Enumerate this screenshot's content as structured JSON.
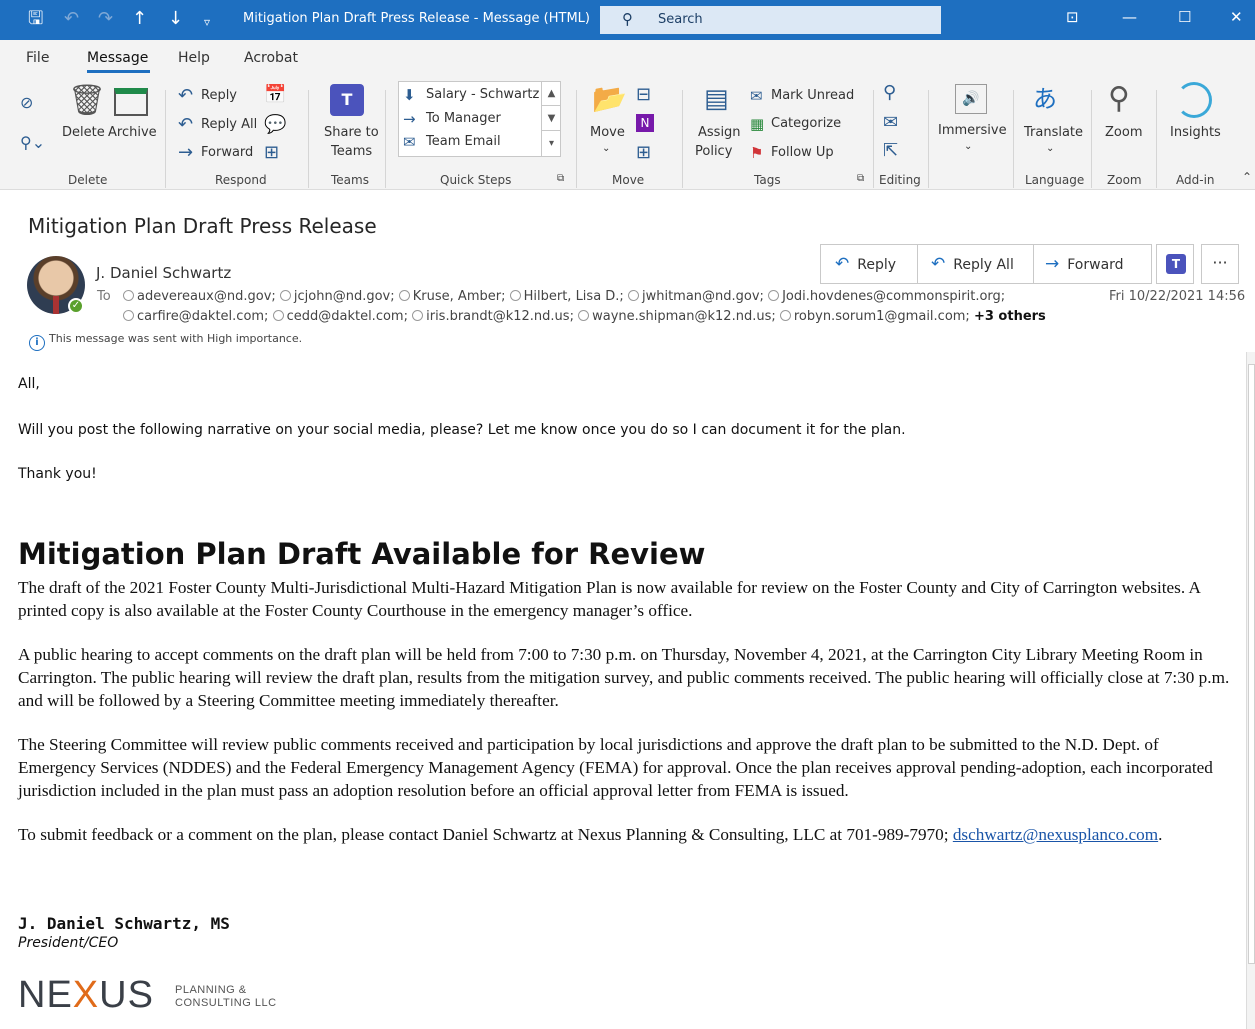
{
  "window": {
    "title": "Mitigation Plan Draft Press Release  -  Message (HTML)",
    "search_placeholder": "Search"
  },
  "menu": {
    "tabs": [
      "File",
      "Message",
      "Help",
      "Acrobat"
    ],
    "active": "Message"
  },
  "ribbon": {
    "delete_group": {
      "delete_label": "Delete",
      "archive_label": "Archive",
      "group_label": "Delete"
    },
    "respond_group": {
      "reply": "Reply",
      "reply_all": "Reply All",
      "forward": "Forward",
      "group_label": "Respond"
    },
    "teams_group": {
      "share_line1": "Share to",
      "share_line2": "Teams",
      "group_label": "Teams"
    },
    "quick_steps": {
      "items": [
        "Salary - Schwartz",
        "To Manager",
        "Team Email"
      ],
      "group_label": "Quick Steps"
    },
    "move_group": {
      "move_label": "Move",
      "group_label": "Move"
    },
    "tags_group": {
      "assign_line1": "Assign",
      "assign_line2": "Policy",
      "mark_unread": "Mark Unread",
      "categorize": "Categorize",
      "follow_up": "Follow Up",
      "group_label": "Tags"
    },
    "editing_group": {
      "group_label": "Editing"
    },
    "immersive_group": {
      "label": "Immersive"
    },
    "language_group": {
      "translate": "Translate",
      "group_label": "Language"
    },
    "zoom_group": {
      "zoom": "Zoom",
      "group_label": "Zoom"
    },
    "addin_group": {
      "insights": "Insights",
      "group_label": "Add-in"
    }
  },
  "message": {
    "subject": "Mitigation Plan Draft Press Release",
    "sender": "J. Daniel Schwartz",
    "to_label": "To",
    "recipients_line1": [
      "adevereaux@nd.gov;",
      "jcjohn@nd.gov;",
      "Kruse, Amber;",
      "Hilbert, Lisa D.;",
      "jwhitman@nd.gov;",
      "Jodi.hovdenes@commonspirit.org;"
    ],
    "recipients_line2": [
      "carfire@daktel.com;",
      "cedd@daktel.com;",
      "iris.brandt@k12.nd.us;",
      "wayne.shipman@k12.nd.us;",
      "robyn.sorum1@gmail.com;"
    ],
    "others": "+3 others",
    "datetime": "Fri 10/22/2021 14:56",
    "importance_note": "This message was sent with High importance.",
    "actions": {
      "reply": "Reply",
      "reply_all": "Reply All",
      "forward": "Forward",
      "more": "···"
    }
  },
  "body": {
    "greeting": "All,",
    "request": "Will you post the following narrative on your social media, please?  Let me know once you do so I can document it for the plan.",
    "thanks": "Thank you!",
    "headline": "Mitigation Plan Draft Available for Review",
    "para1": "The draft of the 2021 Foster County Multi-Jurisdictional Multi-Hazard Mitigation Plan is now available for review on the Foster County and City of Carrington websites.  A printed copy is also available at the Foster County Courthouse in the emergency manager’s office.",
    "para2": "A public hearing to accept comments on the draft plan will be held from 7:00 to 7:30 p.m. on Thursday, November 4, 2021, at the Carrington City Library Meeting Room in Carrington.  The public hearing will review the draft plan, results from the mitigation survey, and public comments received.  The public hearing will officially close at 7:30 p.m. and will be followed by a Steering Committee meeting immediately thereafter.",
    "para3": "The Steering Committee will review public comments received and participation by local jurisdictions and approve the draft plan to be submitted to the N.D. Dept. of Emergency Services (NDDES) and the Federal Emergency Management Agency (FEMA) for approval.  Once the plan receives approval pending-adoption, each incorporated jurisdiction included in the plan must pass an adoption resolution before an official approval letter from FEMA is issued.",
    "para4_text": "To submit feedback or a comment on the plan, please contact Daniel Schwartz at Nexus Planning & Consulting, LLC at 701-989-7970;",
    "para4_email": "dschwartz@nexusplanco.com",
    "signature_name": "J. Daniel Schwartz, MS",
    "signature_title": "President/CEO",
    "logo_main_1": "NE",
    "logo_main_x": "X",
    "logo_main_2": "US",
    "logo_sub_1": "PLANNING &",
    "logo_sub_2": "CONSULTING LLC"
  }
}
